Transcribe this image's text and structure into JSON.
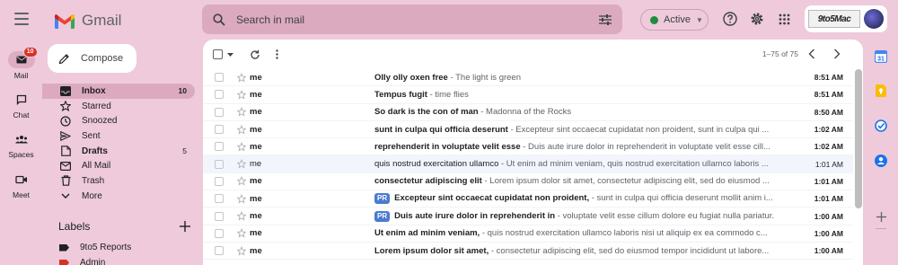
{
  "app": {
    "name": "Gmail"
  },
  "rail": {
    "items": [
      {
        "label": "Mail",
        "badge": "10",
        "icon": "mail-icon"
      },
      {
        "label": "Chat",
        "icon": "chat-icon"
      },
      {
        "label": "Spaces",
        "icon": "spaces-icon"
      },
      {
        "label": "Meet",
        "icon": "meet-icon"
      }
    ]
  },
  "search": {
    "placeholder": "Search in mail"
  },
  "status": {
    "label": "Active",
    "color": "#1e8e3e"
  },
  "account": {
    "brand": "9to5Mac"
  },
  "compose": {
    "label": "Compose"
  },
  "nav": {
    "items": [
      {
        "label": "Inbox",
        "count": "10",
        "icon": "inbox-icon"
      },
      {
        "label": "Starred",
        "count": "",
        "icon": "star-icon"
      },
      {
        "label": "Snoozed",
        "count": "",
        "icon": "clock-icon"
      },
      {
        "label": "Sent",
        "count": "",
        "icon": "send-icon"
      },
      {
        "label": "Drafts",
        "count": "5",
        "icon": "draft-icon"
      },
      {
        "label": "All Mail",
        "count": "",
        "icon": "all-mail-icon"
      },
      {
        "label": "Trash",
        "count": "",
        "icon": "trash-icon"
      },
      {
        "label": "More",
        "count": "",
        "icon": "chevron-down-icon"
      }
    ]
  },
  "labels": {
    "title": "Labels",
    "items": [
      {
        "name": "9to5 Reports",
        "color": "#202124"
      },
      {
        "name": "Admin",
        "color": "#d93025"
      }
    ]
  },
  "toolbar": {
    "pagination": "1–75 of 75"
  },
  "emails": [
    {
      "sender": "me",
      "subject": "Olly olly oxen free",
      "snippet": " - The light is green",
      "time": "8:51 AM",
      "read": false,
      "pr": false
    },
    {
      "sender": "me",
      "subject": "Tempus fugit",
      "snippet": " - time flies",
      "time": "8:51 AM",
      "read": false,
      "pr": false
    },
    {
      "sender": "me",
      "subject": "So dark is the con of man",
      "snippet": " - Madonna of the Rocks",
      "time": "8:50 AM",
      "read": false,
      "pr": false
    },
    {
      "sender": "me",
      "subject": "sunt in culpa qui officia deserunt",
      "snippet": " - Excepteur sint occaecat cupidatat non proident, sunt in culpa qui ...",
      "time": "1:02 AM",
      "read": false,
      "pr": false
    },
    {
      "sender": "me",
      "subject": "reprehenderit in voluptate velit esse",
      "snippet": " - Duis aute irure dolor in reprehenderit in voluptate velit esse cill...",
      "time": "1:02 AM",
      "read": false,
      "pr": false
    },
    {
      "sender": "me",
      "subject": "quis nostrud exercitation ullamco",
      "snippet": " - Ut enim ad minim veniam, quis nostrud exercitation ullamco laboris ...",
      "time": "1:01 AM",
      "read": true,
      "pr": false
    },
    {
      "sender": "me",
      "subject": "consectetur adipiscing elit",
      "snippet": " - Lorem ipsum dolor sit amet, consectetur adipiscing elit, sed do eiusmod ...",
      "time": "1:01 AM",
      "read": false,
      "pr": false
    },
    {
      "sender": "me",
      "subject": "Excepteur sint occaecat cupidatat non proident,",
      "snippet": " - sunt in culpa qui officia deserunt mollit anim i...",
      "time": "1:01 AM",
      "read": false,
      "pr": true
    },
    {
      "sender": "me",
      "subject": "Duis aute irure dolor in reprehenderit in",
      "snippet": " - voluptate velit esse cillum dolore eu fugiat nulla pariatur.",
      "time": "1:00 AM",
      "read": false,
      "pr": true
    },
    {
      "sender": "me",
      "subject": "Ut enim ad minim veniam,",
      "snippet": " - quis nostrud exercitation ullamco laboris nisi ut aliquip ex ea commodo c...",
      "time": "1:00 AM",
      "read": false,
      "pr": false
    },
    {
      "sender": "me",
      "subject": "Lorem ipsum dolor sit amet,",
      "snippet": " - consectetur adipiscing elit, sed do eiusmod tempor incididunt ut labore...",
      "time": "1:00 AM",
      "read": false,
      "pr": false
    }
  ],
  "pr_badge": "PR",
  "side_panel": {
    "icons": [
      "calendar-icon",
      "keep-icon",
      "tasks-icon",
      "contacts-icon",
      "add-icon"
    ]
  }
}
